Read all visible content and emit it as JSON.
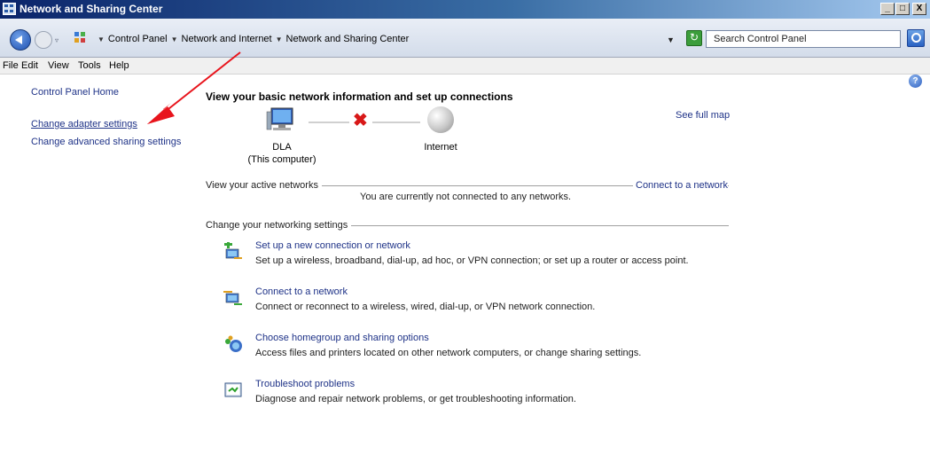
{
  "window": {
    "title": "Network and Sharing Center",
    "minimize": "_",
    "maximize": "□",
    "close": "X"
  },
  "address": {
    "breadcrumbs": [
      "Control Panel",
      "Network and Internet",
      "Network and Sharing Center"
    ],
    "search_placeholder": "Search Control Panel"
  },
  "menu": {
    "items": [
      "File",
      "Edit",
      "View",
      "Tools",
      "Help"
    ]
  },
  "left_pane": {
    "home": "Control Panel Home",
    "adapter": "Change adapter settings",
    "advanced": "Change advanced sharing settings"
  },
  "main": {
    "heading": "View your basic network information and set up connections",
    "see_full_map": "See full map",
    "computer_name": "DLA",
    "computer_sub": "(This computer)",
    "internet_label": "Internet",
    "active_networks_label": "View your active networks",
    "connect_to_network": "Connect to a network",
    "not_connected": "You are currently not connected to any networks.",
    "change_settings_label": "Change your networking settings",
    "tasks": [
      {
        "title": "Set up a new connection or network",
        "desc": "Set up a wireless, broadband, dial-up, ad hoc, or VPN connection; or set up a router or access point."
      },
      {
        "title": "Connect to a network",
        "desc": "Connect or reconnect to a wireless, wired, dial-up, or VPN network connection."
      },
      {
        "title": "Choose homegroup and sharing options",
        "desc": "Access files and printers located on other network computers, or change sharing settings."
      },
      {
        "title": "Troubleshoot problems",
        "desc": "Diagnose and repair network problems, or get troubleshooting information."
      }
    ]
  },
  "colors": {
    "link": "#1e3287",
    "annotation_arrow": "#e8141c",
    "title_bar": "#0a246a"
  }
}
